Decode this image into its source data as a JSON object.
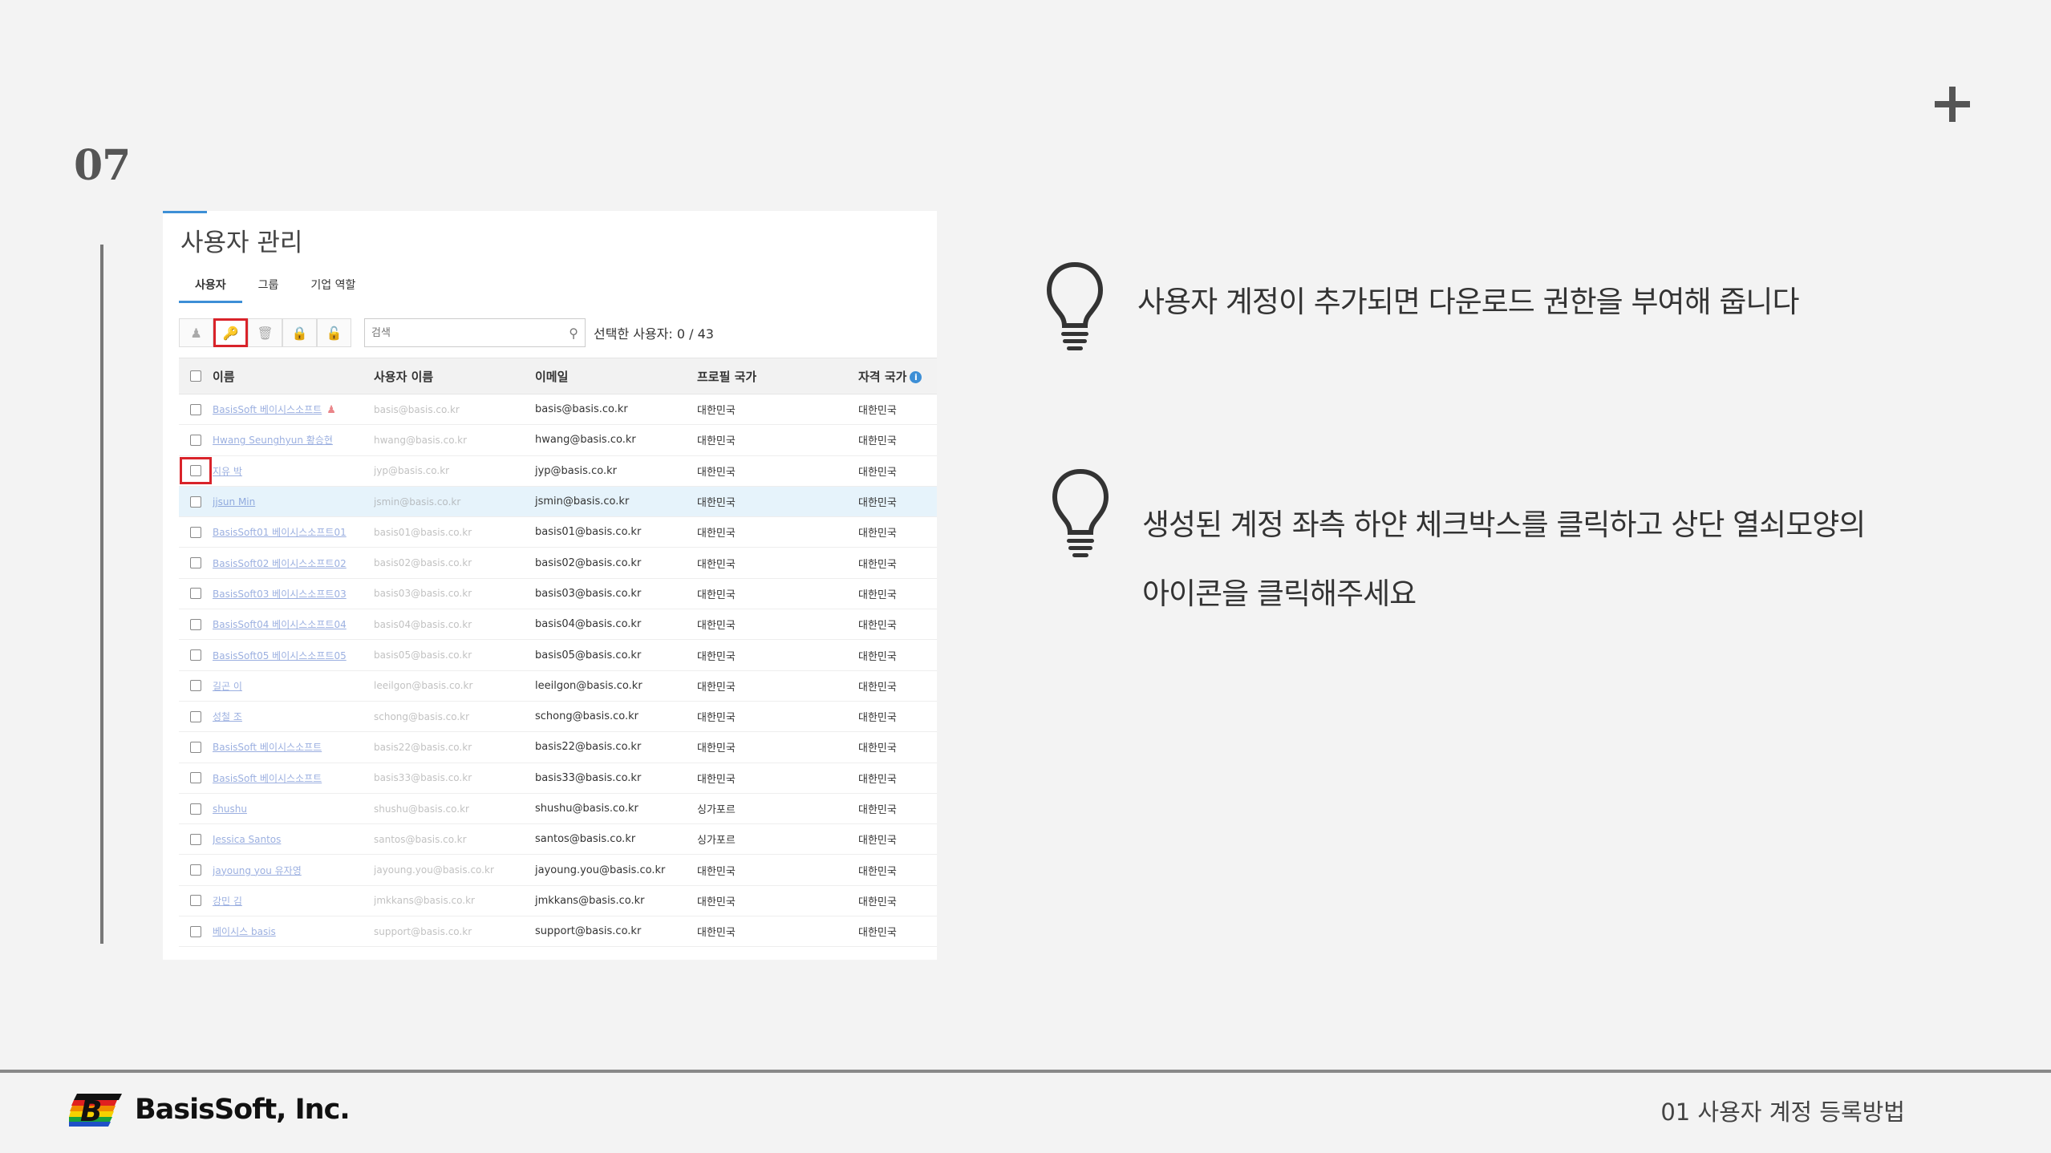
{
  "slide": {
    "number": "07",
    "caption": "01 사용자 계정 등록방법"
  },
  "brand": {
    "logo_text": "BasisSoft, Inc."
  },
  "screenshot": {
    "title": "사용자 관리",
    "tabs": [
      {
        "label": "사용자",
        "active": true
      },
      {
        "label": "그룹",
        "active": false
      },
      {
        "label": "기업 역할",
        "active": false
      }
    ],
    "search_placeholder": "검색",
    "selected_count": "선택한 사용자: 0 / 43",
    "columns": {
      "name": "이름",
      "username": "사용자 이름",
      "email": "이메일",
      "profile_country": "프로필 국가",
      "qual_country": "자격 국가"
    },
    "rows": [
      {
        "name": "BasisSoft 베이시스소프트",
        "username": "basis@basis.co.kr",
        "email": "basis@basis.co.kr",
        "country": "대한민국",
        "qual": "대한민국",
        "admin": true
      },
      {
        "name": "Hwang Seunghyun 황승현",
        "username": "hwang@basis.co.kr",
        "email": "hwang@basis.co.kr",
        "country": "대한민국",
        "qual": "대한민국"
      },
      {
        "name": "지유 박",
        "username": "jyp@basis.co.kr",
        "email": "jyp@basis.co.kr",
        "country": "대한민국",
        "qual": "대한민국",
        "checkbox_highlight": true
      },
      {
        "name": "jjsun Min",
        "username": "jsmin@basis.co.kr",
        "email": "jsmin@basis.co.kr",
        "country": "대한민국",
        "qual": "대한민국",
        "highlight": true
      },
      {
        "name": "BasisSoft01 베이시스소프트01",
        "username": "basis01@basis.co.kr",
        "email": "basis01@basis.co.kr",
        "country": "대한민국",
        "qual": "대한민국"
      },
      {
        "name": "BasisSoft02 베이시스소프트02",
        "username": "basis02@basis.co.kr",
        "email": "basis02@basis.co.kr",
        "country": "대한민국",
        "qual": "대한민국"
      },
      {
        "name": "BasisSoft03 베이시스소프트03",
        "username": "basis03@basis.co.kr",
        "email": "basis03@basis.co.kr",
        "country": "대한민국",
        "qual": "대한민국"
      },
      {
        "name": "BasisSoft04 베이시스소프트04",
        "username": "basis04@basis.co.kr",
        "email": "basis04@basis.co.kr",
        "country": "대한민국",
        "qual": "대한민국"
      },
      {
        "name": "BasisSoft05 베이시스소프트05",
        "username": "basis05@basis.co.kr",
        "email": "basis05@basis.co.kr",
        "country": "대한민국",
        "qual": "대한민국"
      },
      {
        "name": "길곤 이",
        "username": "leeilgon@basis.co.kr",
        "email": "leeilgon@basis.co.kr",
        "country": "대한민국",
        "qual": "대한민국"
      },
      {
        "name": "성철 조",
        "username": "schong@basis.co.kr",
        "email": "schong@basis.co.kr",
        "country": "대한민국",
        "qual": "대한민국"
      },
      {
        "name": "BasisSoft 베이시스소프트",
        "username": "basis22@basis.co.kr",
        "email": "basis22@basis.co.kr",
        "country": "대한민국",
        "qual": "대한민국"
      },
      {
        "name": "BasisSoft 베이시스소프트",
        "username": "basis33@basis.co.kr",
        "email": "basis33@basis.co.kr",
        "country": "대한민국",
        "qual": "대한민국"
      },
      {
        "name": "shushu",
        "username": "shushu@basis.co.kr",
        "email": "shushu@basis.co.kr",
        "country": "싱가포르",
        "qual": "대한민국"
      },
      {
        "name": "Jessica Santos",
        "username": "santos@basis.co.kr",
        "email": "santos@basis.co.kr",
        "country": "싱가포르",
        "qual": "대한민국"
      },
      {
        "name": "jayoung you 유자영",
        "username": "jayoung.you@basis.co.kr",
        "email": "jayoung.you@basis.co.kr",
        "country": "대한민국",
        "qual": "대한민국"
      },
      {
        "name": "강민 김",
        "username": "jmkkans@basis.co.kr",
        "email": "jmkkans@basis.co.kr",
        "country": "대한민국",
        "qual": "대한민국"
      },
      {
        "name": "베이시스 basis",
        "username": "support@basis.co.kr",
        "email": "support@basis.co.kr",
        "country": "대한민국",
        "qual": "대한민국"
      }
    ]
  },
  "tips": [
    {
      "icon": "lightbulb-icon",
      "lines": [
        "사용자 계정이 추가되면 다운로드 권한을 부여해 줍니다"
      ]
    },
    {
      "icon": "lightbulb-icon",
      "lines": [
        "생성된 계정 좌측 하얀 체크박스를 클릭하고 상단 열쇠모양의",
        "아이콘을 클릭해주세요"
      ]
    }
  ],
  "colors": {
    "accent": "#3d8fd6",
    "highlight_red": "#d9232a",
    "row_highlight": "#e6f3fb"
  }
}
